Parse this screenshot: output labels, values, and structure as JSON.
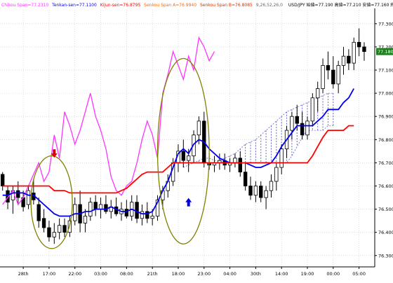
{
  "chart_data": {
    "type": "candlestick",
    "pair": "USD/JPY",
    "header": {
      "chikou": "Chikou Span=77.2310",
      "tenkan": "Tenkan-sen=77.1100",
      "kijun": "Kijun-sen=76.8795",
      "senkou_a": "Senkou Span A=76.9940",
      "senkou_b": "Senkou Span B=76.8085",
      "params": "9,26,52,26,0",
      "quote": "USD/JPY 始値=77.190 高値=77.210 安値=77.160 終値=77.180"
    },
    "price_tag": "77.180",
    "ylim": [
      76.26,
      77.36
    ],
    "y_ticks": [
      "77.300",
      "77.200",
      "77.100",
      "77.000",
      "76.900",
      "76.800",
      "76.700",
      "76.600",
      "76.500",
      "76.400",
      "76.300"
    ],
    "x_ticks": [
      {
        "i": 4,
        "label": "28th"
      },
      {
        "i": 9,
        "label": "17:00"
      },
      {
        "i": 14,
        "label": "22:00"
      },
      {
        "i": 19,
        "label": "03:00"
      },
      {
        "i": 24,
        "label": "08:00"
      },
      {
        "i": 29,
        "label": "21th"
      },
      {
        "i": 34,
        "label": "18:00"
      },
      {
        "i": 39,
        "label": "23:00"
      },
      {
        "i": 44,
        "label": "04:00"
      },
      {
        "i": 49,
        "label": "30th"
      },
      {
        "i": 54,
        "label": "14:00"
      },
      {
        "i": 59,
        "label": "19:00"
      },
      {
        "i": 64,
        "label": "00:00"
      },
      {
        "i": 69,
        "label": "05:00"
      }
    ],
    "candles": [
      {
        "o": 76.65,
        "h": 76.66,
        "l": 76.58,
        "c": 76.6
      },
      {
        "o": 76.58,
        "h": 76.6,
        "l": 76.5,
        "c": 76.53
      },
      {
        "o": 76.54,
        "h": 76.6,
        "l": 76.48,
        "c": 76.58
      },
      {
        "o": 76.58,
        "h": 76.62,
        "l": 76.52,
        "c": 76.55
      },
      {
        "o": 76.55,
        "h": 76.58,
        "l": 76.49,
        "c": 76.51
      },
      {
        "o": 76.52,
        "h": 76.6,
        "l": 76.5,
        "c": 76.58
      },
      {
        "o": 76.57,
        "h": 76.63,
        "l": 76.52,
        "c": 76.54
      },
      {
        "o": 76.52,
        "h": 76.55,
        "l": 76.42,
        "c": 76.45
      },
      {
        "o": 76.46,
        "h": 76.5,
        "l": 76.4,
        "c": 76.42
      },
      {
        "o": 76.42,
        "h": 76.45,
        "l": 76.36,
        "c": 76.38
      },
      {
        "o": 76.38,
        "h": 76.44,
        "l": 76.35,
        "c": 76.4
      },
      {
        "o": 76.4,
        "h": 76.46,
        "l": 76.37,
        "c": 76.43
      },
      {
        "o": 76.43,
        "h": 76.46,
        "l": 76.38,
        "c": 76.4
      },
      {
        "o": 76.4,
        "h": 76.47,
        "l": 76.38,
        "c": 76.45
      },
      {
        "o": 76.45,
        "h": 76.55,
        "l": 76.43,
        "c": 76.52
      },
      {
        "o": 76.52,
        "h": 76.58,
        "l": 76.4,
        "c": 76.44
      },
      {
        "o": 76.44,
        "h": 76.5,
        "l": 76.4,
        "c": 76.47
      },
      {
        "o": 76.47,
        "h": 76.55,
        "l": 76.45,
        "c": 76.53
      },
      {
        "o": 76.53,
        "h": 76.56,
        "l": 76.47,
        "c": 76.5
      },
      {
        "o": 76.5,
        "h": 76.55,
        "l": 76.46,
        "c": 76.52
      },
      {
        "o": 76.52,
        "h": 76.56,
        "l": 76.48,
        "c": 76.49
      },
      {
        "o": 76.49,
        "h": 76.54,
        "l": 76.46,
        "c": 76.51
      },
      {
        "o": 76.51,
        "h": 76.55,
        "l": 76.47,
        "c": 76.48
      },
      {
        "o": 76.48,
        "h": 76.53,
        "l": 76.45,
        "c": 76.5
      },
      {
        "o": 76.5,
        "h": 76.54,
        "l": 76.46,
        "c": 76.47
      },
      {
        "o": 76.47,
        "h": 76.56,
        "l": 76.45,
        "c": 76.53
      },
      {
        "o": 76.53,
        "h": 76.56,
        "l": 76.44,
        "c": 76.46
      },
      {
        "o": 76.46,
        "h": 76.52,
        "l": 76.43,
        "c": 76.49
      },
      {
        "o": 76.49,
        "h": 76.53,
        "l": 76.44,
        "c": 76.46
      },
      {
        "o": 76.46,
        "h": 76.5,
        "l": 76.43,
        "c": 76.47
      },
      {
        "o": 76.47,
        "h": 76.56,
        "l": 76.45,
        "c": 76.54
      },
      {
        "o": 76.54,
        "h": 76.6,
        "l": 76.5,
        "c": 76.58
      },
      {
        "o": 76.58,
        "h": 76.65,
        "l": 76.55,
        "c": 76.62
      },
      {
        "o": 76.62,
        "h": 76.72,
        "l": 76.6,
        "c": 76.7
      },
      {
        "o": 76.7,
        "h": 76.78,
        "l": 76.66,
        "c": 76.75
      },
      {
        "o": 76.75,
        "h": 76.8,
        "l": 76.68,
        "c": 76.71
      },
      {
        "o": 76.71,
        "h": 76.76,
        "l": 76.66,
        "c": 76.73
      },
      {
        "o": 76.73,
        "h": 76.84,
        "l": 76.7,
        "c": 76.82
      },
      {
        "o": 76.82,
        "h": 76.9,
        "l": 76.78,
        "c": 76.88
      },
      {
        "o": 76.88,
        "h": 76.92,
        "l": 76.68,
        "c": 76.7
      },
      {
        "o": 76.7,
        "h": 76.74,
        "l": 76.67,
        "c": 76.69
      },
      {
        "o": 76.69,
        "h": 76.73,
        "l": 76.66,
        "c": 76.7
      },
      {
        "o": 76.7,
        "h": 76.74,
        "l": 76.67,
        "c": 76.71
      },
      {
        "o": 76.71,
        "h": 76.74,
        "l": 76.67,
        "c": 76.69
      },
      {
        "o": 76.69,
        "h": 76.72,
        "l": 76.66,
        "c": 76.7
      },
      {
        "o": 76.7,
        "h": 76.74,
        "l": 76.68,
        "c": 76.72
      },
      {
        "o": 76.72,
        "h": 76.75,
        "l": 76.64,
        "c": 76.66
      },
      {
        "o": 76.66,
        "h": 76.7,
        "l": 76.58,
        "c": 76.6
      },
      {
        "o": 76.6,
        "h": 76.64,
        "l": 76.54,
        "c": 76.56
      },
      {
        "o": 76.56,
        "h": 76.62,
        "l": 76.53,
        "c": 76.6
      },
      {
        "o": 76.6,
        "h": 76.62,
        "l": 76.53,
        "c": 76.55
      },
      {
        "o": 76.55,
        "h": 76.6,
        "l": 76.5,
        "c": 76.58
      },
      {
        "o": 76.58,
        "h": 76.65,
        "l": 76.55,
        "c": 76.62
      },
      {
        "o": 76.62,
        "h": 76.7,
        "l": 76.58,
        "c": 76.68
      },
      {
        "o": 76.68,
        "h": 76.78,
        "l": 76.65,
        "c": 76.76
      },
      {
        "o": 76.76,
        "h": 76.86,
        "l": 76.72,
        "c": 76.84
      },
      {
        "o": 76.84,
        "h": 76.92,
        "l": 76.8,
        "c": 76.9
      },
      {
        "o": 76.9,
        "h": 76.95,
        "l": 76.84,
        "c": 76.87
      },
      {
        "o": 76.87,
        "h": 76.92,
        "l": 76.8,
        "c": 76.82
      },
      {
        "o": 76.82,
        "h": 76.9,
        "l": 76.8,
        "c": 76.88
      },
      {
        "o": 76.88,
        "h": 77.0,
        "l": 76.86,
        "c": 76.98
      },
      {
        "o": 76.98,
        "h": 77.05,
        "l": 76.92,
        "c": 77.02
      },
      {
        "o": 77.02,
        "h": 77.15,
        "l": 77.0,
        "c": 77.12
      },
      {
        "o": 77.12,
        "h": 77.18,
        "l": 77.06,
        "c": 77.1
      },
      {
        "o": 77.1,
        "h": 77.16,
        "l": 77.02,
        "c": 77.04
      },
      {
        "o": 77.04,
        "h": 77.14,
        "l": 77.0,
        "c": 77.12
      },
      {
        "o": 77.12,
        "h": 77.2,
        "l": 77.08,
        "c": 77.16
      },
      {
        "o": 77.16,
        "h": 77.19,
        "l": 77.1,
        "c": 77.13
      },
      {
        "o": 77.13,
        "h": 77.24,
        "l": 77.1,
        "c": 77.22
      },
      {
        "o": 77.22,
        "h": 77.28,
        "l": 77.16,
        "c": 77.2
      },
      {
        "o": 77.2,
        "h": 77.22,
        "l": 77.14,
        "c": 77.18
      }
    ],
    "series": [
      {
        "name": "Chikou Span",
        "color": "#ff33ff",
        "start": 0,
        "values": [
          76.52,
          76.55,
          76.58,
          76.52,
          76.55,
          76.6,
          76.65,
          76.7,
          76.62,
          76.66,
          76.82,
          76.72,
          76.92,
          76.86,
          76.78,
          76.84,
          76.92,
          77.0,
          76.9,
          76.84,
          76.76,
          76.64,
          76.58,
          76.56,
          76.6,
          76.62,
          76.7,
          76.8,
          76.88,
          76.82,
          76.72,
          77.0,
          77.08,
          77.18,
          77.12,
          77.06,
          77.16,
          77.1,
          77.24,
          77.2,
          77.14,
          77.18
        ]
      },
      {
        "name": "Tenkan-sen",
        "color": "#0000ee",
        "start": 0,
        "values": [
          76.56,
          76.56,
          76.57,
          76.57,
          76.57,
          76.56,
          76.56,
          76.54,
          76.52,
          76.5,
          76.48,
          76.47,
          76.47,
          76.47,
          76.48,
          76.48,
          76.49,
          76.49,
          76.5,
          76.5,
          76.5,
          76.51,
          76.5,
          76.49,
          76.49,
          76.5,
          76.49,
          76.48,
          76.48,
          76.49,
          76.53,
          76.58,
          76.62,
          76.68,
          76.74,
          76.76,
          76.74,
          76.78,
          76.8,
          76.79,
          76.76,
          76.74,
          76.72,
          76.71,
          76.7,
          76.7,
          76.7,
          76.7,
          76.69,
          76.68,
          76.68,
          76.69,
          76.7,
          76.73,
          76.77,
          76.8,
          76.83,
          76.86,
          76.86,
          76.86,
          76.86,
          76.88,
          76.9,
          76.93,
          76.93,
          76.93,
          76.96,
          76.98,
          77.02
        ]
      },
      {
        "name": "Kijun-sen",
        "color": "#ff0000",
        "start": 0,
        "values": [
          76.6,
          76.6,
          76.6,
          76.6,
          76.6,
          76.6,
          76.6,
          76.6,
          76.6,
          76.6,
          76.58,
          76.58,
          76.58,
          76.57,
          76.57,
          76.57,
          76.57,
          76.57,
          76.57,
          76.57,
          76.57,
          76.57,
          76.57,
          76.58,
          76.59,
          76.61,
          76.63,
          76.65,
          76.66,
          76.66,
          76.66,
          76.66,
          76.68,
          76.7,
          76.7,
          76.7,
          76.7,
          76.7,
          76.7,
          76.7,
          76.7,
          76.7,
          76.7,
          76.7,
          76.7,
          76.7,
          76.7,
          76.7,
          76.7,
          76.7,
          76.7,
          76.7,
          76.7,
          76.7,
          76.7,
          76.7,
          76.7,
          76.7,
          76.7,
          76.7,
          76.73,
          76.77,
          76.81,
          76.84,
          76.84,
          76.84,
          76.84,
          76.86,
          76.86
        ]
      }
    ],
    "cloud": {
      "color": "#6666cc",
      "start": 35,
      "span_a": [
        76.68,
        76.69,
        76.7,
        76.71,
        76.72,
        76.72,
        76.71,
        76.71,
        76.72,
        76.73,
        76.74,
        76.76,
        76.78,
        76.79,
        76.8,
        76.82,
        76.84,
        76.86,
        76.88,
        76.9,
        76.92,
        76.93,
        76.94,
        76.95,
        76.96,
        76.97,
        76.98,
        76.99,
        77.0,
        77.0
      ],
      "span_b": [
        76.7,
        76.7,
        76.7,
        76.7,
        76.7,
        76.7,
        76.7,
        76.7,
        76.7,
        76.7,
        76.7,
        76.7,
        76.7,
        76.7,
        76.7,
        76.7,
        76.7,
        76.7,
        76.7,
        76.7,
        76.7,
        76.73,
        76.77,
        76.81,
        76.84,
        76.84,
        76.84,
        76.84,
        76.86,
        76.86
      ]
    },
    "annotations": [
      {
        "type": "ellipse",
        "i_center": 9.5,
        "y_center": 76.53,
        "i_radius": 4,
        "y_radius": 0.2,
        "color": "#808000"
      },
      {
        "type": "ellipse",
        "i_center": 35,
        "y_center": 76.75,
        "i_radius": 5,
        "y_radius": 0.4,
        "color": "#808000"
      },
      {
        "type": "arrow-down",
        "i": 10,
        "y": 76.74,
        "color": "#dd0000"
      },
      {
        "type": "arrow-up",
        "i": 36,
        "y": 76.53,
        "color": "#0000dd"
      }
    ]
  }
}
